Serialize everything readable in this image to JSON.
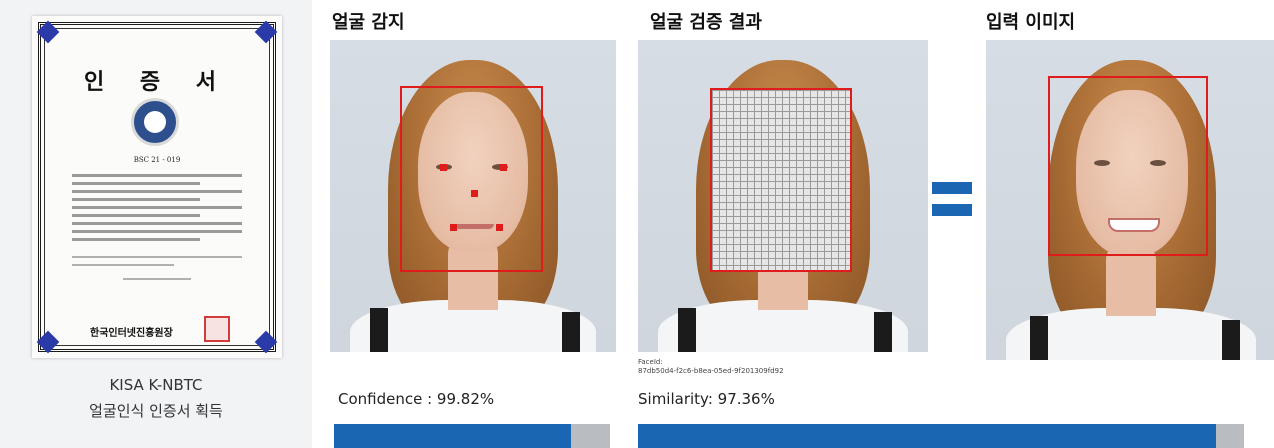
{
  "certificate": {
    "title": "인 증 서",
    "number": "BSC 21 - 019",
    "org_name": "한국인터넷진흥원장",
    "caption_line1": "KISA K-NBTC",
    "caption_line2": "얼굴인식 인증서 획득"
  },
  "sections": {
    "detection_title": "얼굴 감지",
    "verification_title": "얼굴 검증 결과",
    "input_title": "입력 이미지"
  },
  "face_id": {
    "label": "FaceId:",
    "value": "87db50d4-f2c6-b8ea-05ed-9f201309fd92"
  },
  "metrics": {
    "confidence_label": "Confidence : 99.82%",
    "confidence_value": 99.82,
    "similarity_label": "Similarity: 97.36%",
    "similarity_value": 97.36
  },
  "colors": {
    "accent_blue": "#1a66b3",
    "detect_red": "#e01b1b",
    "bar_track": "#b9bcc1"
  }
}
